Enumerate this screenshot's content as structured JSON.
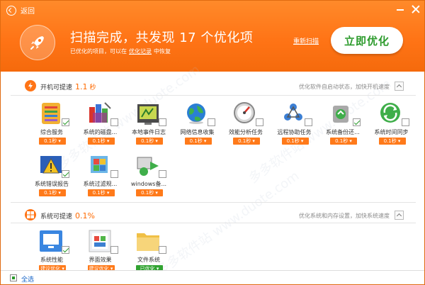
{
  "header": {
    "back_label": "返回",
    "title": "扫描完成，共发现 17 个优化项",
    "subtitle_pre": "已优化的项目，可以在",
    "subtitle_link": "优化记录",
    "subtitle_post": "中恢复",
    "rescan_label": "重新扫描",
    "optimize_label": "立即优化"
  },
  "startup": {
    "label": "开机可提速",
    "value": "1.1",
    "unit": "秒",
    "desc": "优化软件自启动状态，加快开机速度",
    "items": [
      {
        "name": "综合服务",
        "speed": "0.1秒",
        "checked": true,
        "icon": "generic-service-icon"
      },
      {
        "name": "系统的磁盘...",
        "speed": "0.1秒",
        "checked": false,
        "icon": "disk-cleanup-icon"
      },
      {
        "name": "本地事件日志",
        "speed": "0.1秒",
        "checked": false,
        "icon": "event-log-icon"
      },
      {
        "name": "网络信息收集",
        "speed": "0.1秒",
        "checked": false,
        "icon": "network-globe-icon"
      },
      {
        "name": "效能分析任务",
        "speed": "0.1秒",
        "checked": false,
        "icon": "performance-gauge-icon"
      },
      {
        "name": "远程协助任务",
        "speed": "0.1秒",
        "checked": false,
        "icon": "remote-network-icon"
      },
      {
        "name": "系统备份还...",
        "speed": "0.1秒",
        "checked": true,
        "icon": "backup-restore-icon"
      },
      {
        "name": "系统时间同步",
        "speed": "0.1秒",
        "checked": false,
        "icon": "time-sync-icon"
      },
      {
        "name": "系统错误报告",
        "speed": "0.1秒",
        "checked": true,
        "icon": "error-report-icon"
      },
      {
        "name": "系统过滤规...",
        "speed": "0.1秒",
        "checked": false,
        "icon": "filter-rules-icon"
      },
      {
        "name": "windows备...",
        "speed": "0.1秒",
        "checked": false,
        "icon": "windows-backup-icon"
      }
    ]
  },
  "system": {
    "label": "系统可提速",
    "value": "0.1%",
    "desc": "优化系统和内存设置，加快系统速度",
    "items": [
      {
        "name": "系统性能",
        "status": "建议优化",
        "checked": true,
        "icon": "monitor-icon"
      },
      {
        "name": "界面效果",
        "status": "建议优化",
        "checked": false,
        "icon": "ui-effects-icon"
      },
      {
        "name": "文件系统",
        "status": "已优化",
        "checked": false,
        "icon": "folder-icon"
      }
    ]
  },
  "footer": {
    "select_all_label": "全选"
  },
  "watermark": "多多软件站 www.duote.com",
  "colors": {
    "accent": "#ff7416",
    "green": "#31a331",
    "link": "#1a66c8"
  }
}
